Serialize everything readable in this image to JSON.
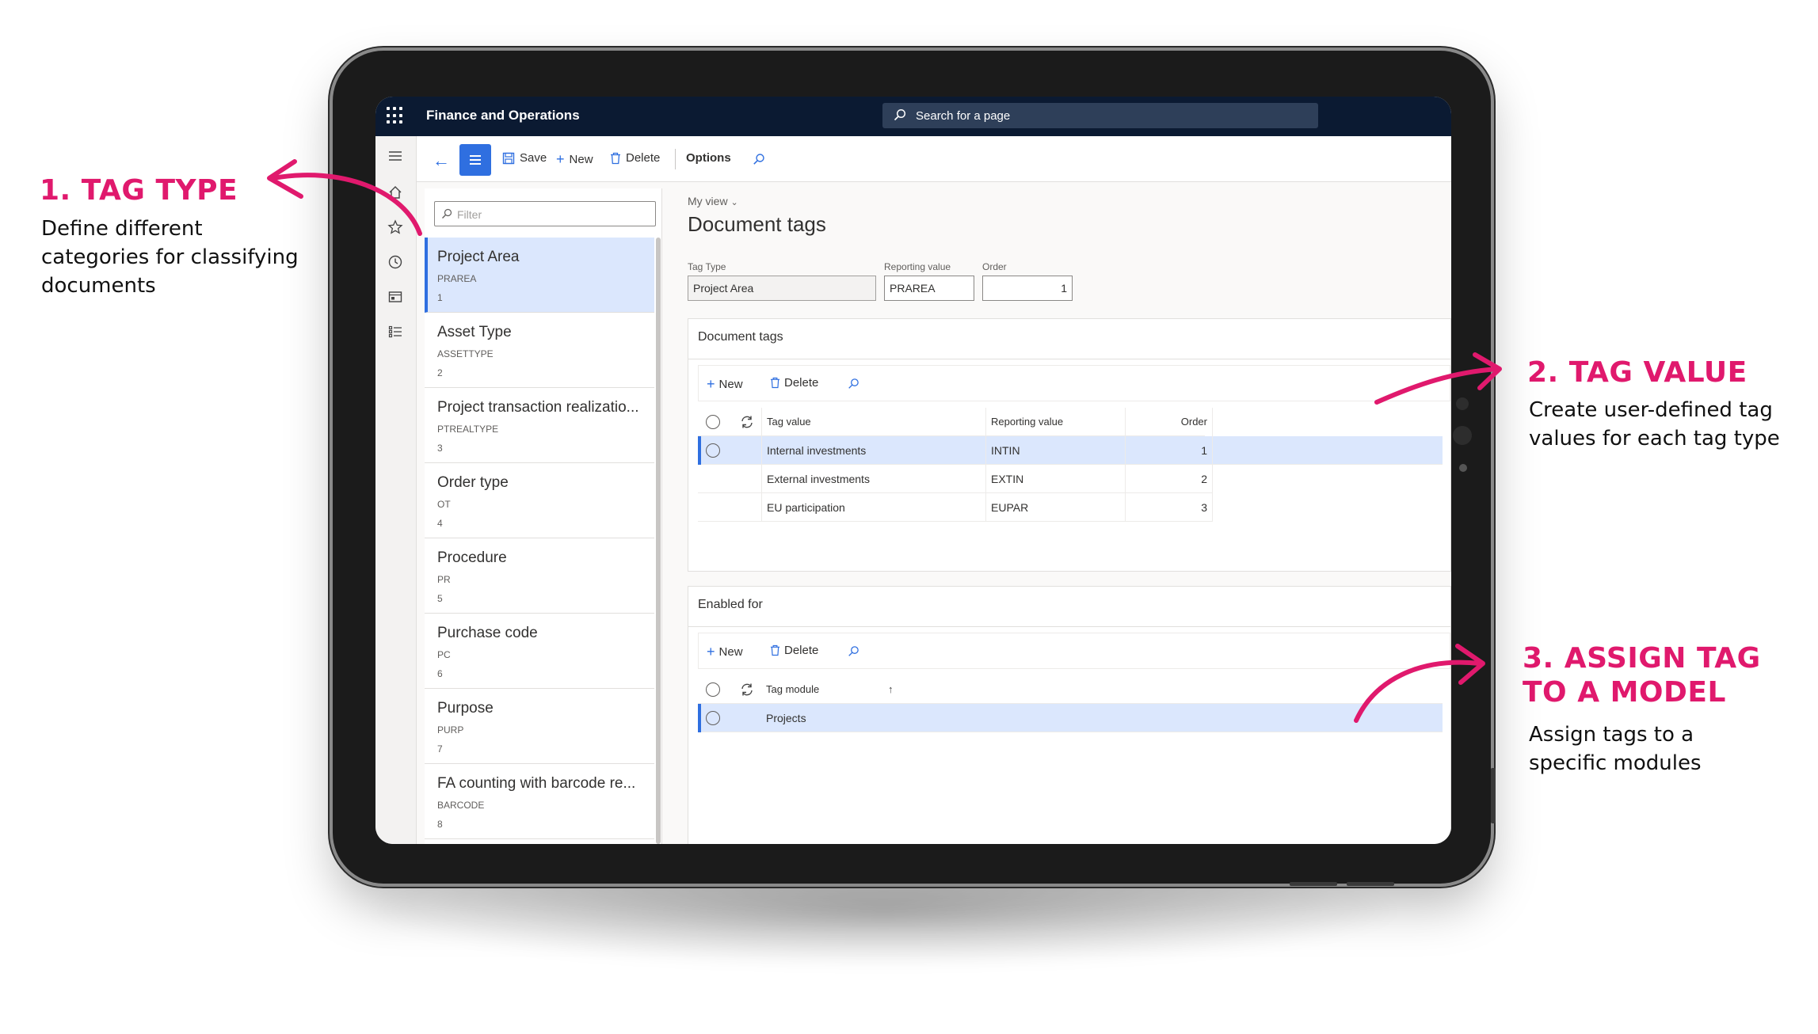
{
  "annotations": {
    "tag_type": {
      "heading": "1. TAG TYPE",
      "lines": [
        "Define different",
        "categories for classifying",
        "documents"
      ]
    },
    "tag_value": {
      "heading": "2. TAG VALUE",
      "lines": [
        "Create user-defined tag",
        "values for each tag type"
      ]
    },
    "assign": {
      "heading_lines": [
        "3. ASSIGN TAG",
        "TO A MODEL"
      ],
      "lines": [
        "Assign tags to a",
        "specific modules"
      ]
    },
    "accent_color": "#e0196d"
  },
  "app": {
    "name": "Finance and Operations",
    "search_placeholder": "Search for a page",
    "topbar_color": "#0b1a32",
    "accent_color": "#2f6fe0"
  },
  "rail_icons": [
    "hamburger-icon",
    "home-icon",
    "star-icon",
    "clock-icon",
    "workspace-icon",
    "list-icon"
  ],
  "actionbar": {
    "save": "Save",
    "new": "New",
    "delete": "Delete",
    "options": "Options"
  },
  "listpanel": {
    "filter_placeholder": "Filter",
    "items": [
      {
        "name": "Project Area",
        "code": "PRAREA",
        "order": "1"
      },
      {
        "name": "Asset Type",
        "code": "ASSETTYPE",
        "order": "2"
      },
      {
        "name": "Project transaction realizatio...",
        "code": "PTREALTYPE",
        "order": "3"
      },
      {
        "name": "Order type",
        "code": "OT",
        "order": "4"
      },
      {
        "name": "Procedure",
        "code": "PR",
        "order": "5"
      },
      {
        "name": "Purchase code",
        "code": "PC",
        "order": "6"
      },
      {
        "name": "Purpose",
        "code": "PURP",
        "order": "7"
      },
      {
        "name": "FA counting with barcode re...",
        "code": "BARCODE",
        "order": "8"
      }
    ]
  },
  "main": {
    "my_view": "My view",
    "title": "Document tags",
    "fields": {
      "tag_type": {
        "label": "Tag Type",
        "value": "Project Area"
      },
      "reporting_value": {
        "label": "Reporting value",
        "value": "PRAREA"
      },
      "order": {
        "label": "Order",
        "value": "1"
      }
    },
    "document_tags": {
      "title": "Document tags",
      "new": "New",
      "delete": "Delete",
      "columns": {
        "tag_value": "Tag value",
        "reporting_value": "Reporting value",
        "order": "Order"
      },
      "rows": [
        {
          "tag_value": "Internal investments",
          "reporting_value": "INTIN",
          "order": "1"
        },
        {
          "tag_value": "External investments",
          "reporting_value": "EXTIN",
          "order": "2"
        },
        {
          "tag_value": "EU participation",
          "reporting_value": "EUPAR",
          "order": "3"
        }
      ]
    },
    "enabled_for": {
      "title": "Enabled for",
      "new": "New",
      "delete": "Delete",
      "columns": {
        "tag_module": "Tag module",
        "sort": "↑"
      },
      "rows": [
        {
          "tag_module": "Projects"
        }
      ]
    }
  }
}
